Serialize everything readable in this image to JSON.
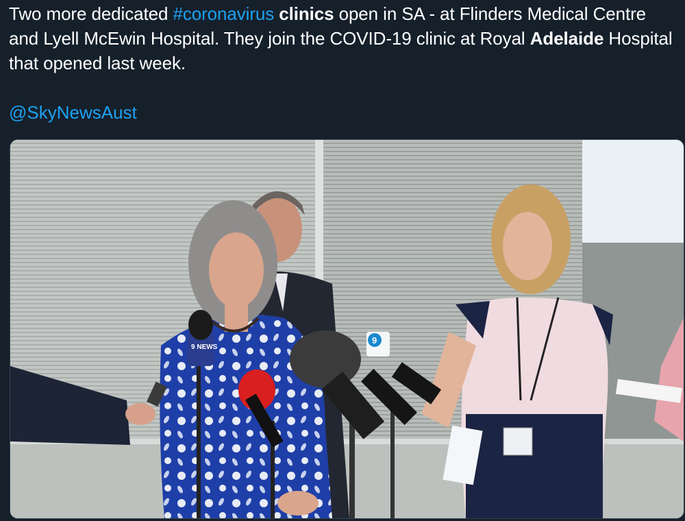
{
  "tweet": {
    "text_parts": {
      "p1": "Two more dedicated ",
      "hashtag": "#coronavirus",
      "p2": " ",
      "bold1": "clinics",
      "p3": " open in SA - at Flinders Medical Centre and Lyell McEwin Hospital. They join the COVID-19 clinic at Royal ",
      "bold2": "Adelaide",
      "p4": " Hospital that opened last week."
    },
    "mention": "@SkyNewsAust"
  },
  "media": {
    "mic_flag_left": "9 NEWS",
    "mic_flag_mid": "9"
  },
  "colors": {
    "background": "#15202b",
    "link": "#1da1f2",
    "text": "#ffffff"
  }
}
